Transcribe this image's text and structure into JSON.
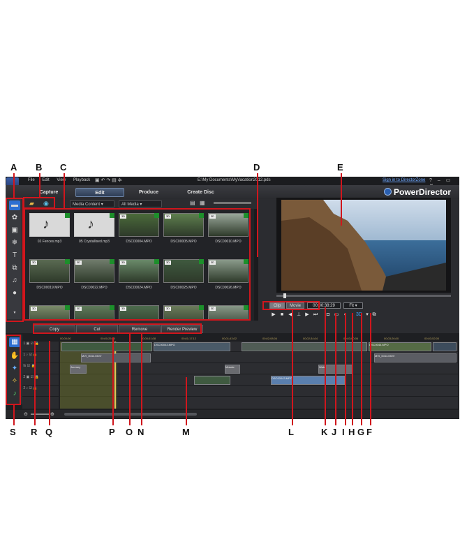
{
  "window": {
    "menu": [
      "File",
      "Edit",
      "View",
      "Playback"
    ],
    "document_title": "E:\\My Documents\\MyVacation2012.pds",
    "sign_in": "Sign in to DirectorZone",
    "controls": [
      "?",
      "–",
      "▭",
      "✕"
    ]
  },
  "modes": [
    {
      "label": "Capture",
      "active": false
    },
    {
      "label": "Edit",
      "active": true
    },
    {
      "label": "Produce",
      "active": false
    },
    {
      "label": "Create Disc",
      "active": false
    }
  ],
  "brand": "PowerDirector",
  "library": {
    "filter_type": "Media Content",
    "filter_media": "All Media",
    "items": [
      {
        "name": "02 Fences.mp3",
        "kind": "audio",
        "checked": true
      },
      {
        "name": "05 Crystallised.mp3",
        "kind": "audio",
        "checked": true
      },
      {
        "name": "DSC00004.MPO",
        "kind": "photo",
        "checked": true
      },
      {
        "name": "DSC00005.MPO",
        "kind": "photo",
        "checked": true
      },
      {
        "name": "DSC00010.MPO",
        "kind": "photo",
        "checked": true
      },
      {
        "name": "DSC00019.MPO",
        "kind": "photo",
        "checked": true
      },
      {
        "name": "DSC00022.MPO",
        "kind": "photo",
        "checked": true
      },
      {
        "name": "DSC00024.MPO",
        "kind": "photo",
        "checked": true
      },
      {
        "name": "DSC00025.MPO",
        "kind": "photo",
        "checked": true
      },
      {
        "name": "DSC00026.MPO",
        "kind": "photo",
        "checked": true
      },
      {
        "name": "",
        "kind": "photo",
        "checked": true
      },
      {
        "name": "",
        "kind": "photo",
        "checked": true
      },
      {
        "name": "",
        "kind": "photo",
        "checked": false
      },
      {
        "name": "",
        "kind": "photo",
        "checked": true
      },
      {
        "name": "",
        "kind": "photo",
        "checked": true
      }
    ],
    "badge_3d": "3D"
  },
  "actions": [
    "Copy",
    "Cut",
    "Remove",
    "Render Preview"
  ],
  "playback": {
    "clip_label": "Clip",
    "movie_label": "Movie",
    "timecode": "00:00:38:29",
    "fit": "Fit"
  },
  "timeline": {
    "ruler": [
      "00;00;00",
      "00;00;25;00",
      "00;00;51;08",
      "00;01;17;12",
      "00;01;43;02",
      "00;02;08;04",
      "00;02;34;04",
      "00;03;00;06",
      "00;03;26;00",
      "00;03;52;00"
    ],
    "clip_labels": [
      "DSC00043.MPO",
      "DSC0044.MPO",
      "MVI_0044.MOV",
      "Journey",
      "Mosaic",
      "Water"
    ]
  },
  "callouts_top": [
    "A",
    "B",
    "C",
    "D",
    "E"
  ],
  "callouts_bottom": [
    "S",
    "R",
    "Q",
    "P",
    "O",
    "N",
    "M",
    "L",
    "K",
    "J",
    "I",
    "H",
    "G",
    "F"
  ],
  "colors": {
    "callout_red": "#d0161d",
    "app_bg": "#2b2c30",
    "check_green": "#1d8f2b",
    "brand_blue": "#2a5fb0"
  }
}
